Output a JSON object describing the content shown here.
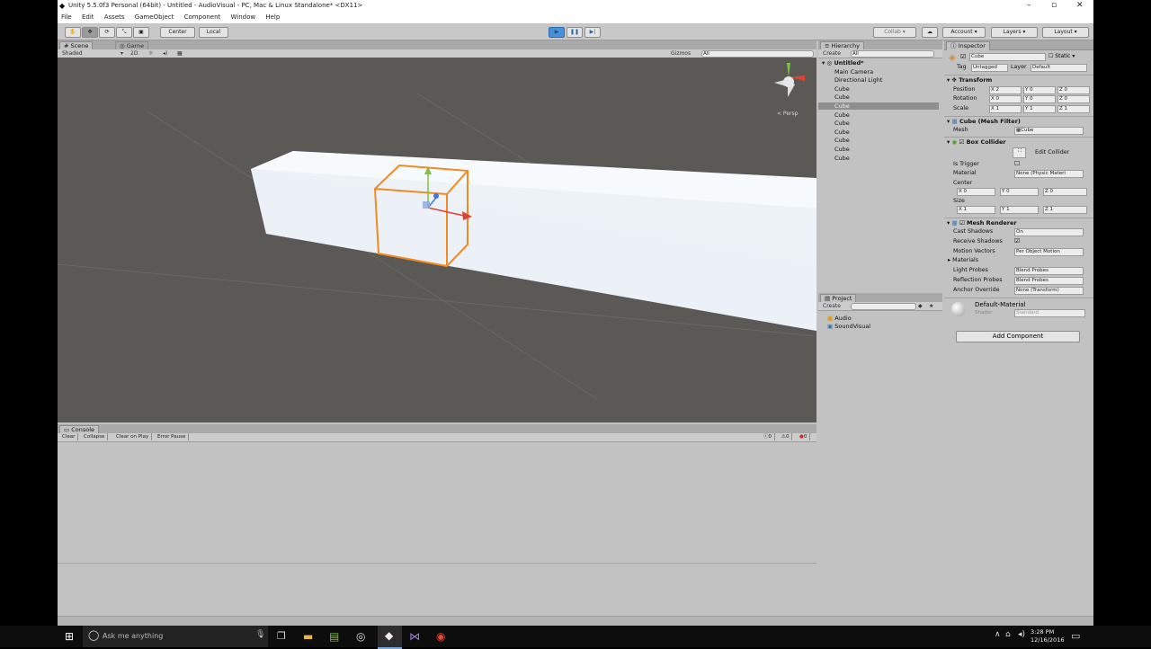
{
  "window": {
    "title": "Unity 5.5.0f3 Personal (64bit) - Untitled - AudioVisual - PC, Mac & Linux Standalone* <DX11>",
    "controls": [
      "–",
      "▫",
      "✕"
    ]
  },
  "menu": [
    "File",
    "Edit",
    "Assets",
    "GameObject",
    "Component",
    "Window",
    "Help"
  ],
  "toolbar": {
    "pivot": "Center",
    "space": "Local",
    "collab": "Collab",
    "account": "Account",
    "layers": "Layers",
    "layout": "Layout"
  },
  "scene": {
    "tabs": [
      "Scene",
      "Game"
    ],
    "shading": "Shaded",
    "mode_2d": "2D",
    "gizmos": "Gizmos",
    "search": "All",
    "persp": "Persp"
  },
  "hierarchy": {
    "tab": "Hierarchy",
    "create": "Create",
    "search": "All",
    "root": "Untitled*",
    "items": [
      "Main Camera",
      "Directional Light",
      "Cube",
      "Cube",
      "Cube",
      "Cube",
      "Cube",
      "Cube",
      "Cube",
      "Cube",
      "Cube"
    ],
    "selected_index": 4
  },
  "project": {
    "tab": "Project",
    "create": "Create",
    "items": [
      "Audio",
      "SoundVisual"
    ]
  },
  "console": {
    "tab": "Console",
    "buttons": [
      "Clear",
      "Collapse",
      "Clear on Play",
      "Error Pause"
    ],
    "counts": [
      "0",
      "0",
      "0"
    ]
  },
  "inspector": {
    "tab": "Inspector",
    "object_name": "Cube",
    "static": "Static",
    "tag_label": "Tag",
    "tag_value": "Untagged",
    "layer_label": "Layer",
    "layer_value": "Default",
    "transform": {
      "title": "Transform",
      "position_label": "Position",
      "rotation_label": "Rotation",
      "scale_label": "Scale",
      "position": [
        "2",
        "0",
        "0"
      ],
      "rotation": [
        "0",
        "0",
        "0"
      ],
      "scale": [
        "1",
        "1",
        "1"
      ]
    },
    "mesh_filter": {
      "title": "Cube (Mesh Filter)",
      "mesh_label": "Mesh",
      "mesh_value": "Cube"
    },
    "box_collider": {
      "title": "Box Collider",
      "edit": "Edit Collider",
      "is_trigger": "Is Trigger",
      "material_label": "Material",
      "material_value": "None (Physic Materi",
      "center_label": "Center",
      "center": [
        "0",
        "0",
        "0"
      ],
      "size_label": "Size",
      "size": [
        "1",
        "1",
        "1"
      ]
    },
    "mesh_renderer": {
      "title": "Mesh Renderer",
      "cast_shadows": "Cast Shadows",
      "cast_shadows_value": "On",
      "receive_shadows": "Receive Shadows",
      "motion_vectors": "Motion Vectors",
      "motion_vectors_value": "Per Object Motion",
      "materials": "Materials",
      "light_probes": "Light Probes",
      "light_probes_value": "Blend Probes",
      "reflection_probes": "Reflection Probes",
      "reflection_probes_value": "Blend Probes",
      "anchor_override": "Anchor Override",
      "anchor_override_value": "None (Transform)"
    },
    "material": {
      "name": "Default-Material",
      "shader_label": "Shader",
      "shader_value": "Standard"
    },
    "add_component": "Add Component"
  },
  "taskbar": {
    "search_placeholder": "Ask me anything",
    "time": "3:28 PM",
    "date": "12/16/2016"
  },
  "colors": {
    "selection_orange": "#f08a24",
    "play_blue": "#4a90d9",
    "scene_bg": "#5b5955"
  }
}
